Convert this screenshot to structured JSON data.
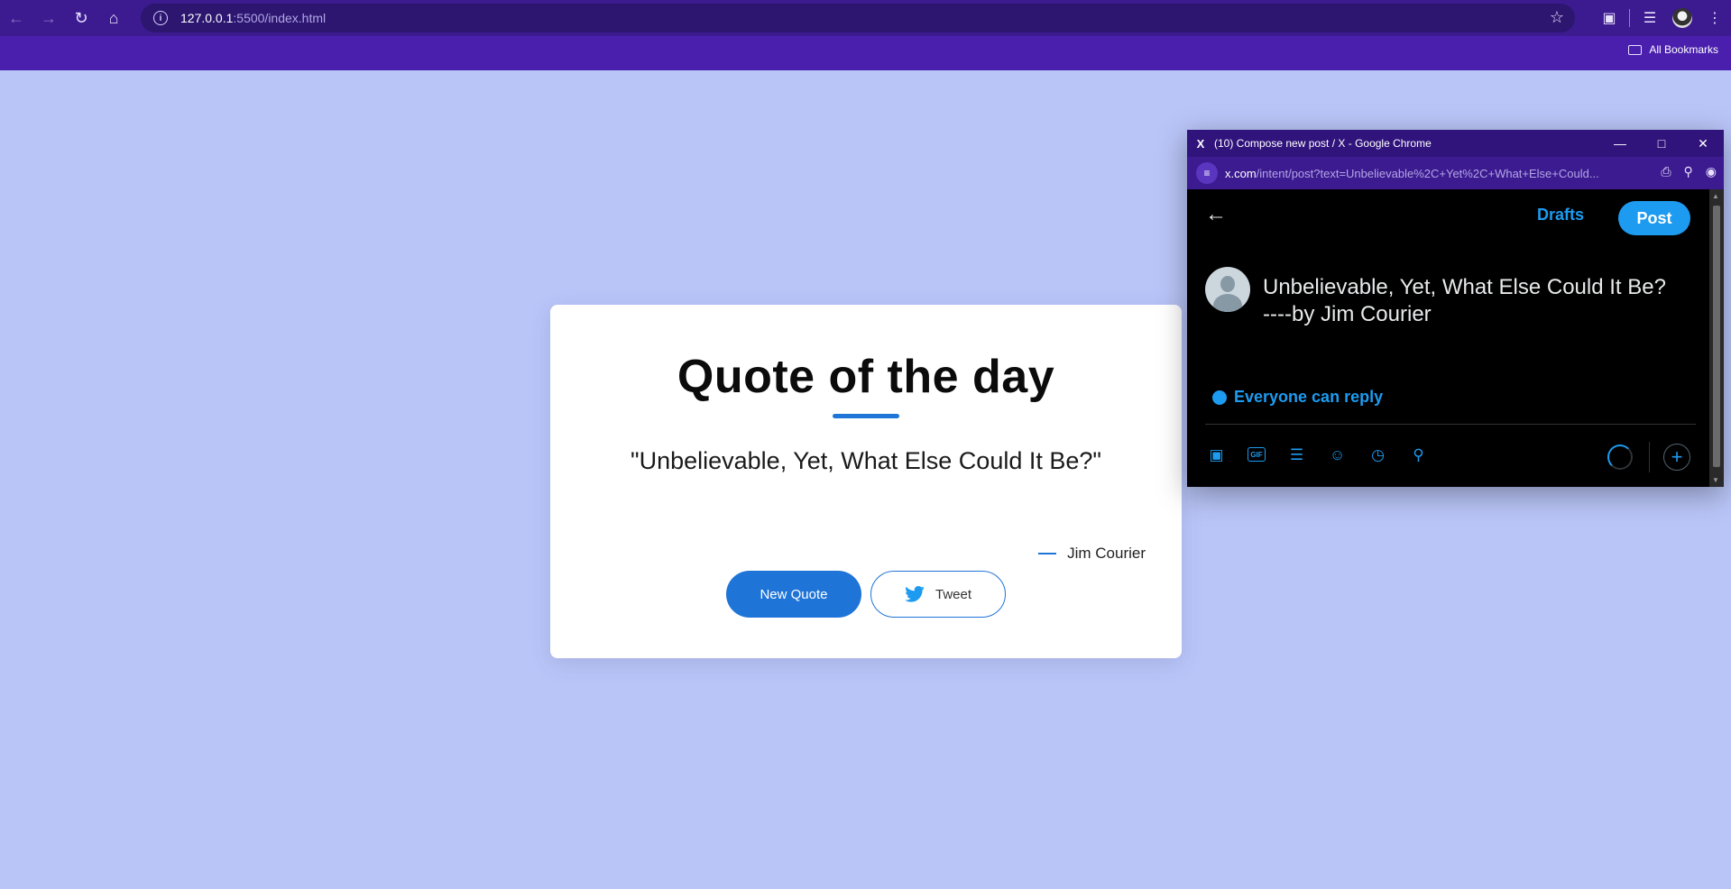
{
  "browser": {
    "url_host": "127.0.0.1",
    "url_rest": ":5500/index.html",
    "bookmarks_label": "All Bookmarks",
    "theme_color": "#4a1fae"
  },
  "page": {
    "title": "Quote of the day",
    "quote": "\"Unbelievable, Yet, What Else Could It Be?\"",
    "author": "Jim Courier",
    "new_quote_label": "New Quote",
    "tweet_label": "Tweet",
    "accent_color": "#1f74d8",
    "background_color": "#b9c5f7"
  },
  "popup": {
    "window_title": "(10) Compose new post / X - Google Chrome",
    "url_host": "x.com",
    "url_rest": "/intent/post?text=Unbelievable%2C+Yet%2C+What+Else+Could...",
    "drafts_label": "Drafts",
    "post_label": "Post",
    "post_line1": "Unbelievable, Yet, What Else Could It Be?",
    "post_line2": "----by Jim Courier",
    "reply_setting": "Everyone can reply",
    "accent_color": "#1d9bf0",
    "tools": [
      "image-icon",
      "gif-icon",
      "poll-icon",
      "emoji-icon",
      "schedule-icon",
      "location-icon"
    ]
  }
}
